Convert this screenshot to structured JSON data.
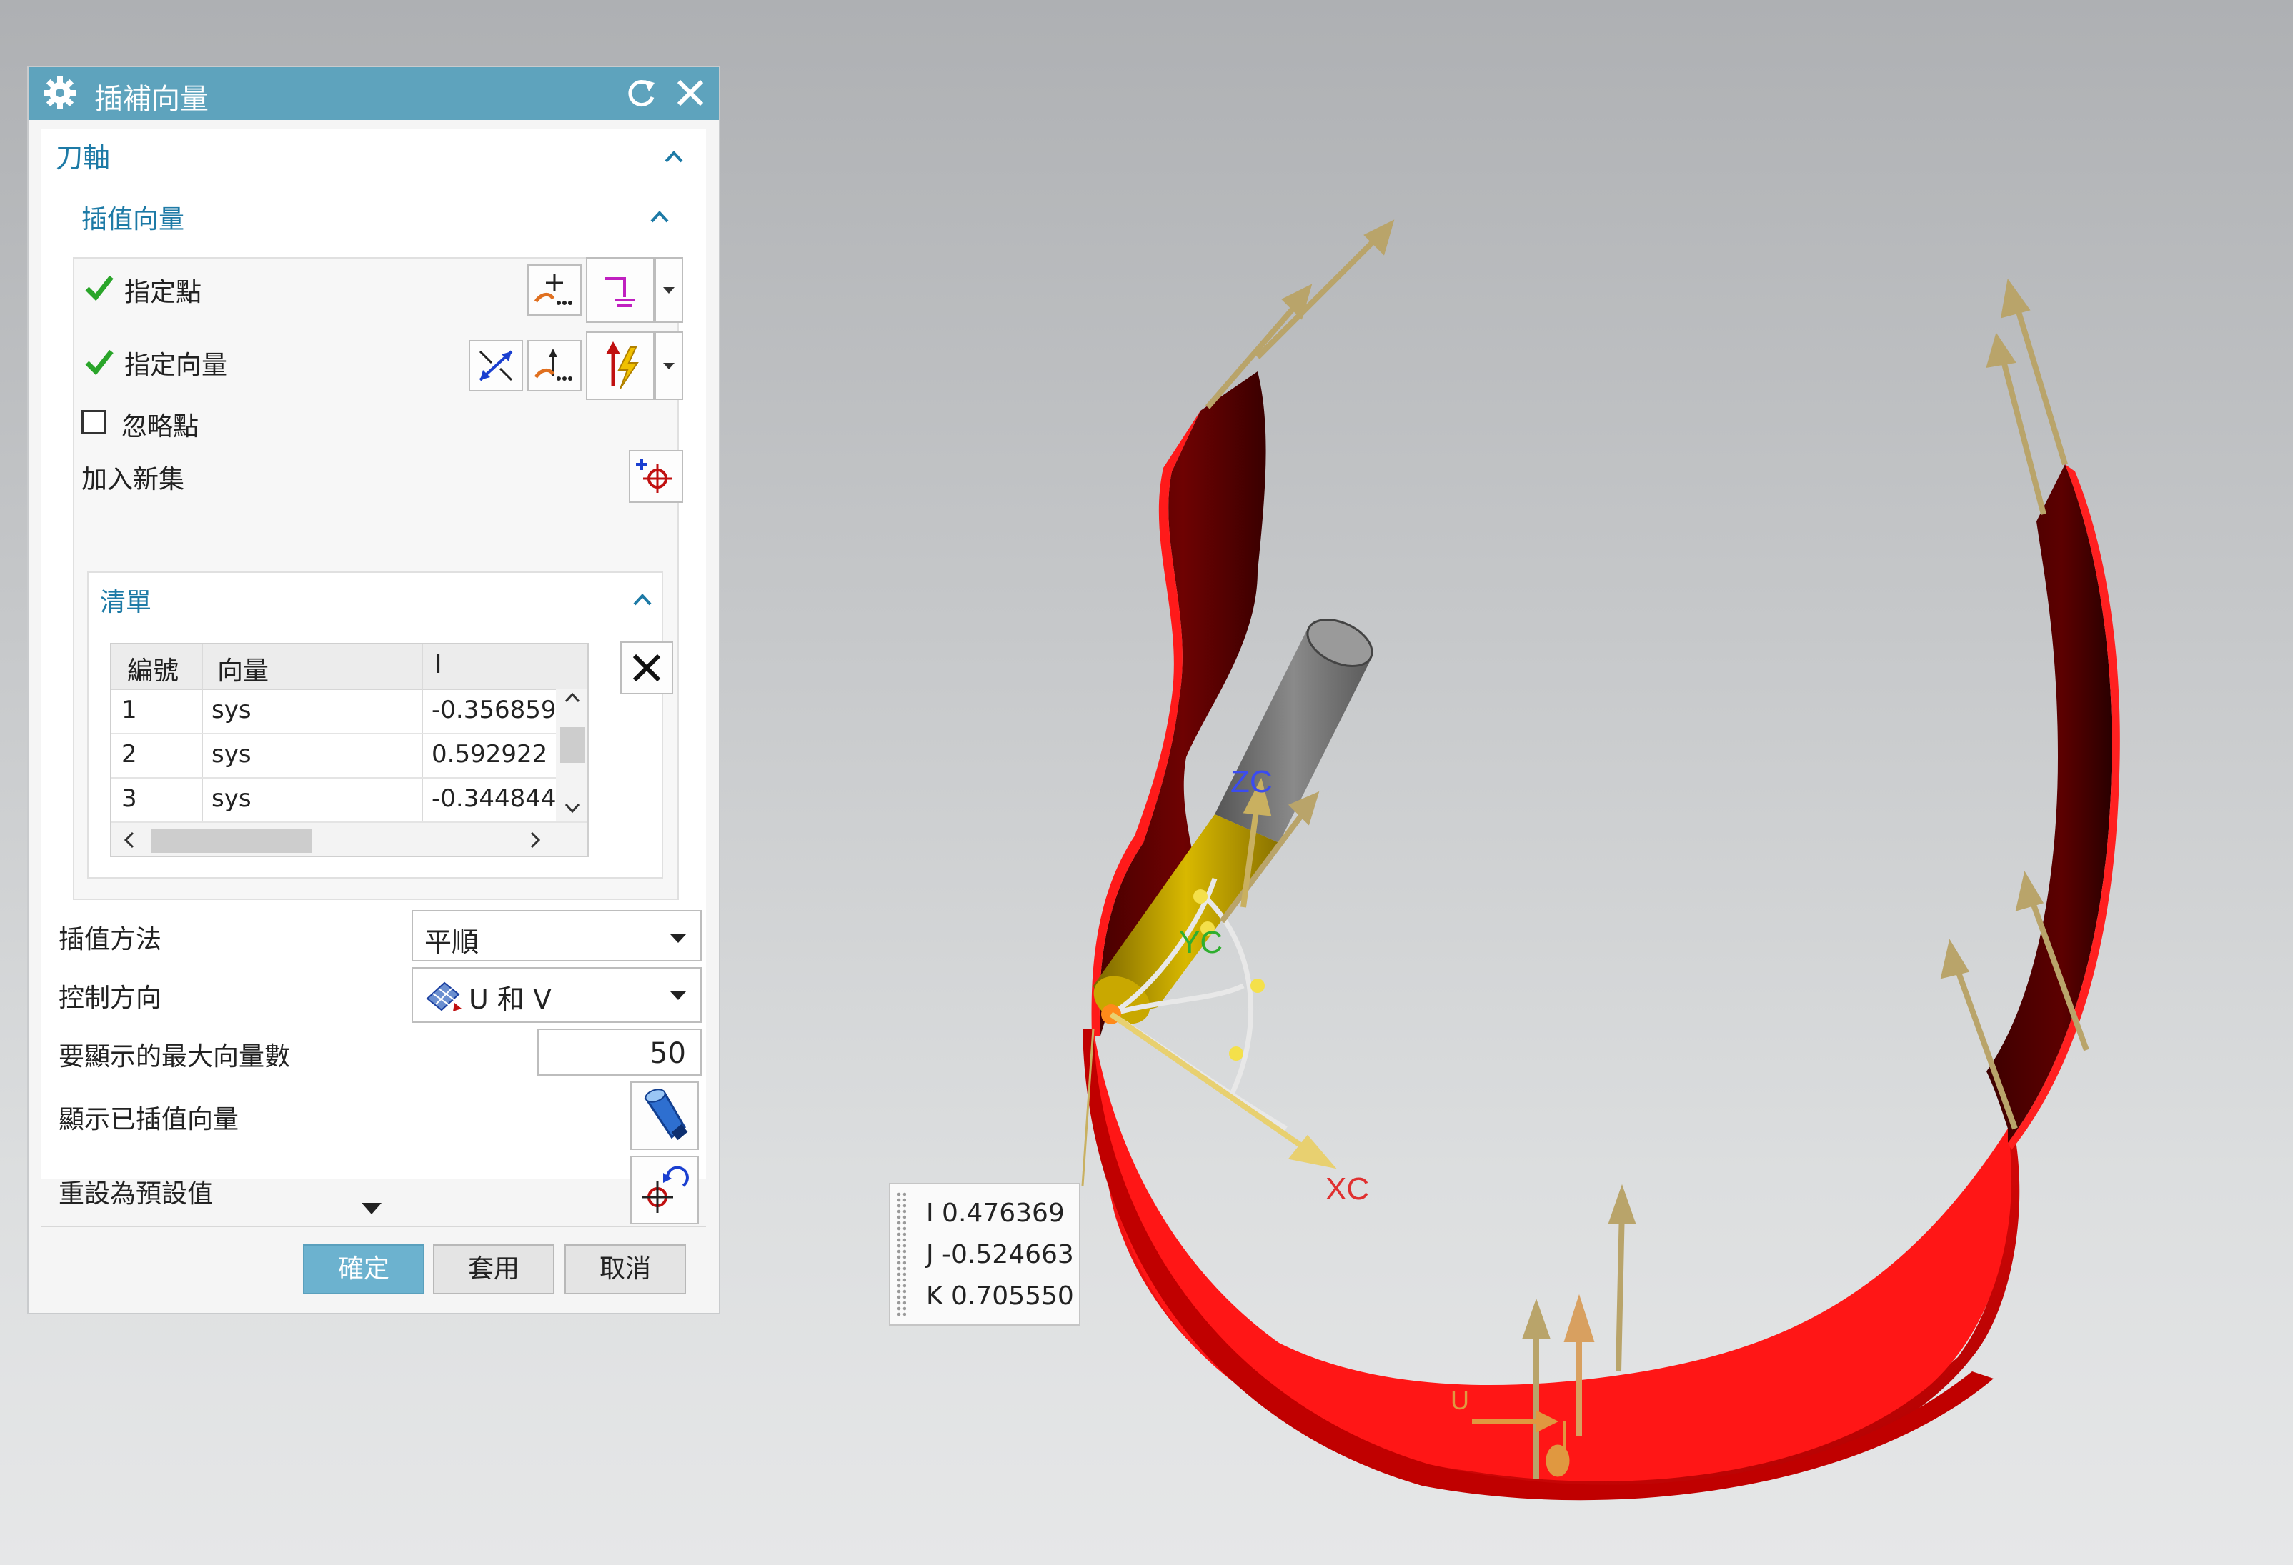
{
  "dialog": {
    "title": "插補向量",
    "section_tool_axis": "刀軸",
    "section_interp_vectors": "插值向量",
    "specify_point": "指定點",
    "specify_vector": "指定向量",
    "ignore_point": "忽略點",
    "ignore_point_checked": false,
    "add_new_set": "加入新集",
    "list_title": "清單",
    "table": {
      "headers": [
        "編號",
        "向量",
        "I"
      ],
      "rows": [
        {
          "num": "1",
          "vector": "sys",
          "i": "-0.356859"
        },
        {
          "num": "2",
          "vector": "sys",
          "i": "0.592922"
        },
        {
          "num": "3",
          "vector": "sys",
          "i": "-0.344844"
        }
      ]
    },
    "interp_method_label": "插值方法",
    "interp_method_value": "平順",
    "control_direction_label": "控制方向",
    "control_direction_value": "U 和 V",
    "max_vectors_label": "要顯示的最大向量數",
    "max_vectors_value": "50",
    "show_interp_label": "顯示已插值向量",
    "reset_default_label": "重設為預設值",
    "ok": "確定",
    "apply": "套用",
    "cancel": "取消"
  },
  "viewport": {
    "vector_tip": {
      "i": "I 0.476369",
      "j": "J -0.524663",
      "k": "K 0.705550"
    },
    "axes": {
      "zc": "ZC",
      "yc": "YC",
      "xc": "XC",
      "u": "U"
    }
  },
  "colors": {
    "titlebar": "#5ea3bd",
    "section_text": "#1d7aa6",
    "ok_button": "#6cb2cf",
    "surface_red": "#e01010",
    "vector_arrow": "#b9a46a",
    "tool_holder": "#c9a800"
  },
  "icons": {
    "title": "gear-icon",
    "reset": "reset-icon",
    "close": "close-icon",
    "check": "checkmark-icon",
    "delete": "delete-x-icon",
    "show": "flashlight-icon",
    "reset_default": "reset-point-icon"
  }
}
